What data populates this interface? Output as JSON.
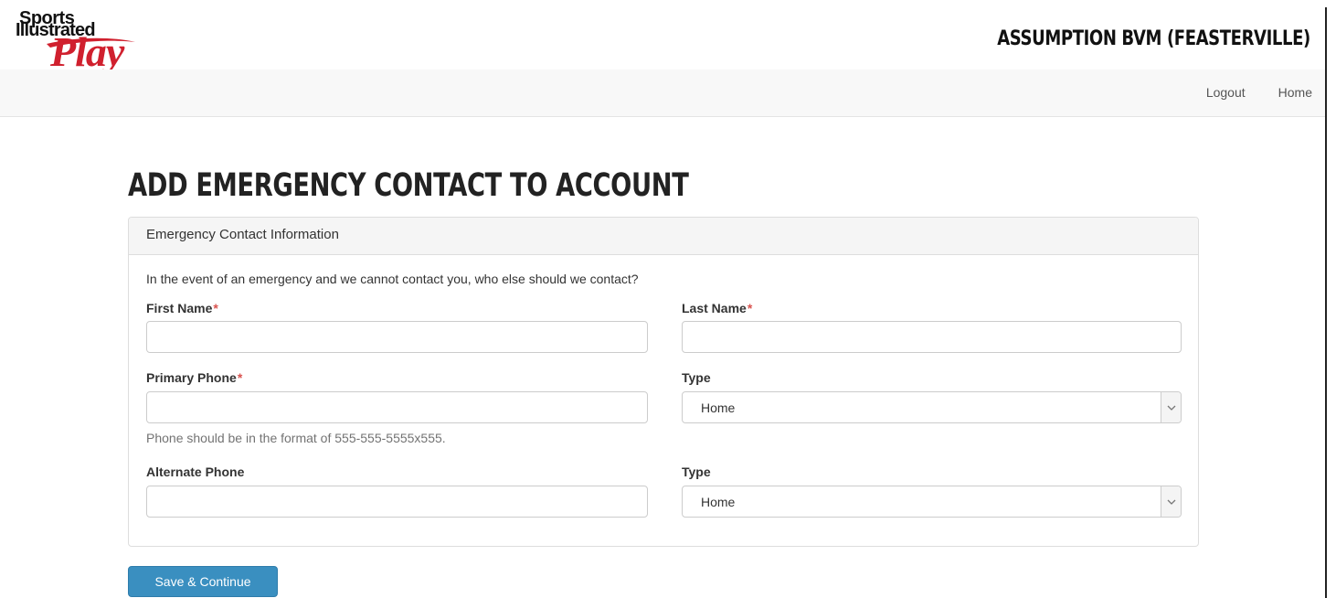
{
  "brand": {
    "logo_line1": "Sports",
    "logo_line2": "Illustrated",
    "logo_line3": "Play",
    "accent_color": "#d0202e"
  },
  "header": {
    "org_name": "ASSUMPTION BVM (FEASTERVILLE)"
  },
  "nav": {
    "logout": "Logout",
    "home": "Home"
  },
  "page": {
    "title": "ADD EMERGENCY CONTACT TO ACCOUNT"
  },
  "panel": {
    "heading": "Emergency Contact Information",
    "intro": "In the event of an emergency and we cannot contact you, who else should we contact?",
    "first_name_label": "First Name",
    "last_name_label": "Last Name",
    "primary_phone_label": "Primary Phone",
    "primary_type_label": "Type",
    "primary_type_value": "Home",
    "phone_help": "Phone should be in the format of 555-555-5555x555.",
    "alternate_phone_label": "Alternate Phone",
    "alternate_type_label": "Type",
    "alternate_type_value": "Home",
    "required_marker": "*"
  },
  "actions": {
    "save_label": "Save & Continue",
    "button_color": "#3a8fc0"
  }
}
